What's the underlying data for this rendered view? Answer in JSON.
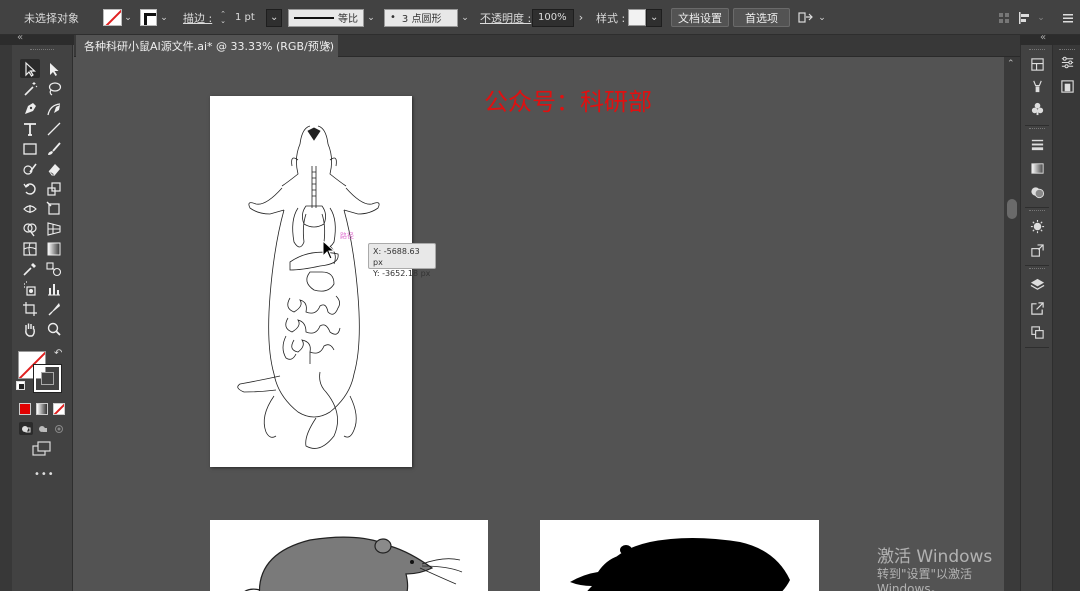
{
  "control_bar": {
    "selection_status": "未选择对象",
    "stroke_label": "描边 :",
    "stroke_weight": "1 pt",
    "stroke_profile": "等比",
    "brush_value": "3 点圆形",
    "brush_dot": "•",
    "opacity_label": "不透明度 :",
    "opacity_value": "100%",
    "style_label": "样式 :",
    "doc_setup_button": "文档设置",
    "preferences_button": "首选项"
  },
  "document": {
    "tab_title": "各种科研小鼠AI源文件.ai* @ 33.33% (RGB/预览)",
    "close_glyph": "×"
  },
  "canvas": {
    "watermark_text": "公众号：科研部",
    "cursor_tooltip": {
      "x": "X: -5688.63 px",
      "y": "Y: -3652.18 px"
    }
  },
  "system": {
    "activate_title": "激活 Windows",
    "activate_sub": "转到\"设置\"以激活 Windows。"
  },
  "colors": {
    "app_background": "#535353",
    "panel": "#424242",
    "watermark_red": "#e01010",
    "fill_red": "#e00000"
  },
  "icons": {
    "collapse_left": "«",
    "collapse_right": "«",
    "more_tools": "•••"
  }
}
